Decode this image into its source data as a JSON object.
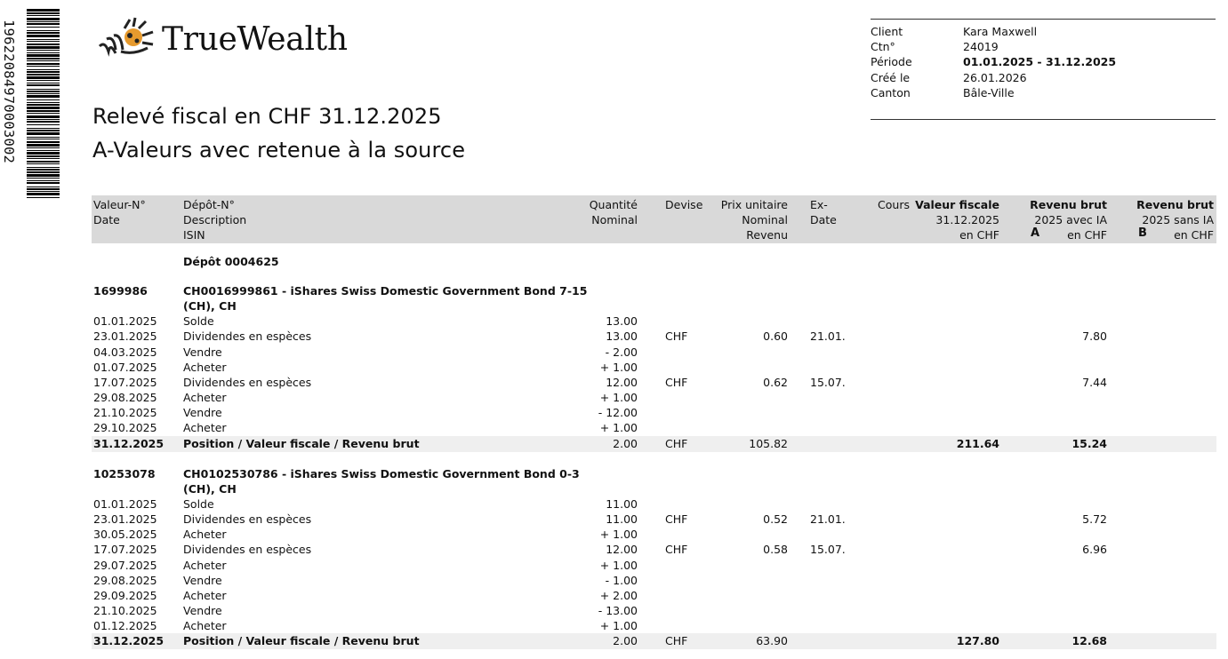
{
  "barcode": {
    "number": "19622084970003002"
  },
  "logo": {
    "text": "TrueWealth"
  },
  "client_info": [
    {
      "label": "Client",
      "value": "Kara Maxwell",
      "bold": false
    },
    {
      "label": "Ctn°",
      "value": "24019",
      "bold": false
    },
    {
      "label": "Période",
      "value": "01.01.2025 - 31.12.2025",
      "bold": true
    },
    {
      "label": "Créé le",
      "value": "26.01.2026",
      "bold": false
    },
    {
      "label": "Canton",
      "value": "Bâle-Ville",
      "bold": false
    }
  ],
  "titles": {
    "line1": "Relevé fiscal en CHF 31.12.2025",
    "line2": "A-Valeurs avec retenue à la source"
  },
  "header": {
    "valeur": [
      "Valeur-N°",
      "Date"
    ],
    "depot": [
      "Dépôt-N°",
      "Description",
      "ISIN"
    ],
    "quantite": [
      "Quantité",
      "Nominal"
    ],
    "devise": [
      "Devise"
    ],
    "prix": [
      "Prix unitaire",
      "Nominal",
      "Revenu"
    ],
    "ex": [
      "Ex-",
      "Date"
    ],
    "cours": [
      "Cours"
    ],
    "valeur_fiscale": [
      "Valeur fiscale",
      "31.12.2025",
      "en CHF"
    ],
    "revenu_a": [
      "Revenu brut",
      "2025 avec IA",
      "en CHF"
    ],
    "revenu_b": [
      "Revenu brut",
      "2025 sans IA",
      "en CHF"
    ],
    "letter_a": "A",
    "letter_b": "B"
  },
  "depot_label": "Dépôt 0004625",
  "securities": [
    {
      "valeur_no": "1699986",
      "desc_line1": "CH0016999861 - iShares Swiss Domestic Government Bond 7-15",
      "desc_line2": "(CH), CH",
      "transactions": [
        {
          "date": "01.01.2025",
          "desc": "Solde",
          "qty": "13.00",
          "devise": "",
          "prix": "",
          "ex": "",
          "revenu_a": ""
        },
        {
          "date": "23.01.2025",
          "desc": "Dividendes en espèces",
          "qty": "13.00",
          "devise": "CHF",
          "prix": "0.60",
          "ex": "21.01.",
          "revenu_a": "7.80"
        },
        {
          "date": "04.03.2025",
          "desc": "Vendre",
          "qty": "- 2.00",
          "devise": "",
          "prix": "",
          "ex": "",
          "revenu_a": ""
        },
        {
          "date": "01.07.2025",
          "desc": "Acheter",
          "qty": "+ 1.00",
          "devise": "",
          "prix": "",
          "ex": "",
          "revenu_a": ""
        },
        {
          "date": "17.07.2025",
          "desc": "Dividendes en espèces",
          "qty": "12.00",
          "devise": "CHF",
          "prix": "0.62",
          "ex": "15.07.",
          "revenu_a": "7.44"
        },
        {
          "date": "29.08.2025",
          "desc": "Acheter",
          "qty": "+ 1.00",
          "devise": "",
          "prix": "",
          "ex": "",
          "revenu_a": ""
        },
        {
          "date": "21.10.2025",
          "desc": "Vendre",
          "qty": "- 12.00",
          "devise": "",
          "prix": "",
          "ex": "",
          "revenu_a": ""
        },
        {
          "date": "29.10.2025",
          "desc": "Acheter",
          "qty": "+ 1.00",
          "devise": "",
          "prix": "",
          "ex": "",
          "revenu_a": ""
        }
      ],
      "total": {
        "date": "31.12.2025",
        "desc": "Position / Valeur fiscale / Revenu brut",
        "qty": "2.00",
        "devise": "CHF",
        "prix": "105.82",
        "valeur_fiscale": "211.64",
        "revenu_a": "15.24"
      }
    },
    {
      "valeur_no": "10253078",
      "desc_line1": "CH0102530786 - iShares Swiss Domestic Government Bond 0-3",
      "desc_line2": "(CH), CH",
      "transactions": [
        {
          "date": "01.01.2025",
          "desc": "Solde",
          "qty": "11.00",
          "devise": "",
          "prix": "",
          "ex": "",
          "revenu_a": ""
        },
        {
          "date": "23.01.2025",
          "desc": "Dividendes en espèces",
          "qty": "11.00",
          "devise": "CHF",
          "prix": "0.52",
          "ex": "21.01.",
          "revenu_a": "5.72"
        },
        {
          "date": "30.05.2025",
          "desc": "Acheter",
          "qty": "+ 1.00",
          "devise": "",
          "prix": "",
          "ex": "",
          "revenu_a": ""
        },
        {
          "date": "17.07.2025",
          "desc": "Dividendes en espèces",
          "qty": "12.00",
          "devise": "CHF",
          "prix": "0.58",
          "ex": "15.07.",
          "revenu_a": "6.96"
        },
        {
          "date": "29.07.2025",
          "desc": "Acheter",
          "qty": "+ 1.00",
          "devise": "",
          "prix": "",
          "ex": "",
          "revenu_a": ""
        },
        {
          "date": "29.08.2025",
          "desc": "Vendre",
          "qty": "- 1.00",
          "devise": "",
          "prix": "",
          "ex": "",
          "revenu_a": ""
        },
        {
          "date": "29.09.2025",
          "desc": "Acheter",
          "qty": "+ 2.00",
          "devise": "",
          "prix": "",
          "ex": "",
          "revenu_a": ""
        },
        {
          "date": "21.10.2025",
          "desc": "Vendre",
          "qty": "- 13.00",
          "devise": "",
          "prix": "",
          "ex": "",
          "revenu_a": ""
        },
        {
          "date": "01.12.2025",
          "desc": "Acheter",
          "qty": "+ 1.00",
          "devise": "",
          "prix": "",
          "ex": "",
          "revenu_a": ""
        }
      ],
      "total": {
        "date": "31.12.2025",
        "desc": "Position / Valeur fiscale / Revenu brut",
        "qty": "2.00",
        "devise": "CHF",
        "prix": "63.90",
        "valeur_fiscale": "127.80",
        "revenu_a": "12.68"
      }
    }
  ]
}
